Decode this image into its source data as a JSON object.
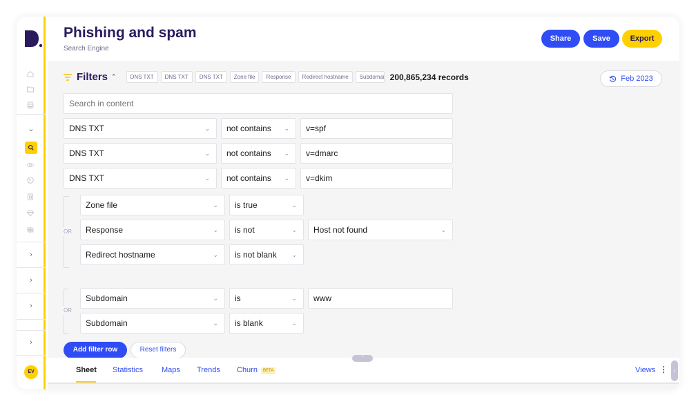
{
  "app": {
    "logo_text": "D.",
    "title": "Phishing and spam",
    "subtitle": "Search Engine",
    "accent_yellow": "#ffd000",
    "accent_blue": "#2f4cf5",
    "brand_dark": "#2a1a5e"
  },
  "header": {
    "share_label": "Share",
    "save_label": "Save",
    "export_label": "Export"
  },
  "sidebar": {
    "toggle_icon": "chevron-right-icon",
    "icons": [
      "home-icon",
      "folder-icon",
      "printer-icon",
      "chevron-down-icon",
      "search-icon",
      "eye-icon",
      "globe-icon",
      "lock-icon",
      "diamond-icon",
      "signpost-icon"
    ],
    "active": "search-icon",
    "collapsed_sections": 4,
    "avatar_initials": "EV"
  },
  "filters": {
    "label": "Filters",
    "chips": [
      "DNS TXT",
      "DNS TXT",
      "DNS TXT",
      "Zone file",
      "Response",
      "Redirect hostname",
      "Subdomain"
    ],
    "records": "200,865,234 records",
    "date_label": "Feb 2023",
    "search_placeholder": "Search in content",
    "rows": [
      {
        "field": "DNS TXT",
        "operator": "not contains",
        "value": "v=spf"
      },
      {
        "field": "DNS TXT",
        "operator": "not contains",
        "value": "v=dmarc"
      },
      {
        "field": "DNS TXT",
        "operator": "not contains",
        "value": "v=dkim"
      }
    ],
    "or_group_1": {
      "label": "OR",
      "rows": [
        {
          "field": "Zone file",
          "operator": "is true",
          "value": ""
        },
        {
          "field": "Response",
          "operator": "is not",
          "value": "Host not found"
        },
        {
          "field": "Redirect hostname",
          "operator": "is not blank",
          "value": ""
        }
      ]
    },
    "or_group_2": {
      "label": "OR",
      "rows": [
        {
          "field": "Subdomain",
          "operator": "is",
          "value": "www"
        },
        {
          "field": "Subdomain",
          "operator": "is blank",
          "value": ""
        }
      ]
    },
    "add_row_label": "Add filter row",
    "reset_label": "Reset filters"
  },
  "tabs": {
    "items": [
      "Sheet",
      "Statistics",
      "Maps",
      "Trends",
      "Churn"
    ],
    "active": "Sheet",
    "beta_badge": "BETA",
    "views_label": "Views"
  }
}
